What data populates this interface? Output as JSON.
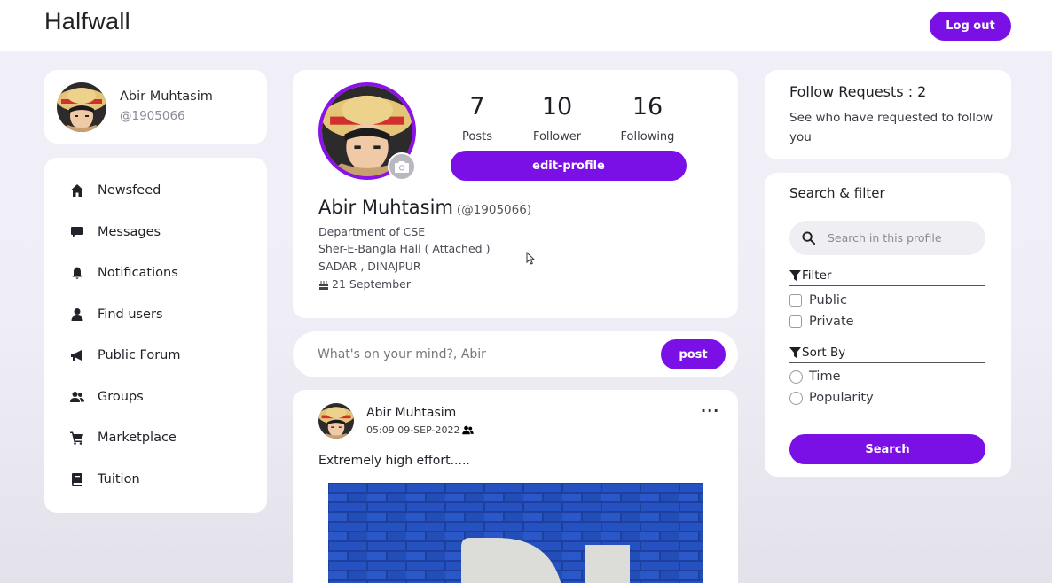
{
  "header": {
    "brand": "Halfwall",
    "logout_label": "Log out",
    "accent": "#7a10e6"
  },
  "user_card": {
    "name": "Abir Muhtasim",
    "handle": "@1905066"
  },
  "nav": {
    "items": [
      {
        "label": "Newsfeed",
        "icon": "home-icon"
      },
      {
        "label": "Messages",
        "icon": "message-icon"
      },
      {
        "label": "Notifications",
        "icon": "bell-icon"
      },
      {
        "label": "Find users",
        "icon": "user-icon"
      },
      {
        "label": "Public Forum",
        "icon": "megaphone-icon"
      },
      {
        "label": "Groups",
        "icon": "users-icon"
      },
      {
        "label": "Marketplace",
        "icon": "cart-icon"
      },
      {
        "label": "Tuition",
        "icon": "book-icon"
      }
    ]
  },
  "profile": {
    "stats": [
      {
        "value": "7",
        "label": "Posts"
      },
      {
        "value": "10",
        "label": "Follower"
      },
      {
        "value": "16",
        "label": "Following"
      }
    ],
    "edit_label": "edit-profile",
    "full_name": "Abir Muhtasim",
    "handle": "(@1905066)",
    "department": "Department of CSE",
    "hall": "Sher-E-Bangla Hall ( Attached )",
    "location": "SADAR , DINAJPUR",
    "birthday": "21 September"
  },
  "composer": {
    "placeholder": "What's on your mind?, Abir",
    "post_label": "post"
  },
  "feed": {
    "author": "Abir Muhtasim",
    "time": "05:09 09-SEP-2022",
    "menu": "···",
    "text": "Extremely high effort....."
  },
  "requests": {
    "title": "Follow Requests : 2",
    "subtitle": "See who have requested to follow you"
  },
  "filter": {
    "title": "Search & filter",
    "search_placeholder": "Search in this profile",
    "filter_heading": "Filter",
    "filter_options": [
      "Public",
      "Private"
    ],
    "sort_heading": "Sort By",
    "sort_options": [
      "Time",
      "Popularity"
    ],
    "search_label": "Search"
  }
}
